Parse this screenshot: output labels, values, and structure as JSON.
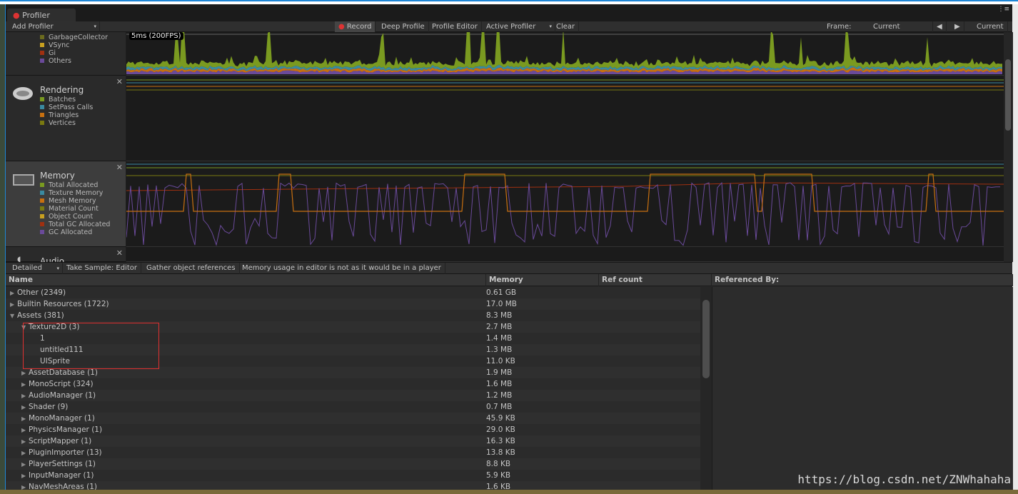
{
  "window": {
    "tab_title": "Profiler"
  },
  "toolbar": {
    "add_profiler": "Add Profiler",
    "record": "Record",
    "deep_profile": "Deep Profile",
    "profile_editor": "Profile Editor",
    "active_profiler": "Active Profiler",
    "clear": "Clear",
    "frame_label": "Frame:",
    "frame_value": "Current",
    "current": "Current"
  },
  "cpu": {
    "fps_label": "5ms (200FPS)",
    "legend": [
      {
        "label": "GarbageCollector",
        "color": "#6b6b1e"
      },
      {
        "label": "VSync",
        "color": "#c8a020"
      },
      {
        "label": "Gi",
        "color": "#a03010"
      },
      {
        "label": "Others",
        "color": "#6a4a9a"
      }
    ]
  },
  "rendering": {
    "title": "Rendering",
    "legend": [
      {
        "label": "Batches",
        "color": "#7a9a20"
      },
      {
        "label": "SetPass Calls",
        "color": "#3a8aa0"
      },
      {
        "label": "Triangles",
        "color": "#c87010"
      },
      {
        "label": "Vertices",
        "color": "#7a7a10"
      }
    ]
  },
  "memory": {
    "title": "Memory",
    "legend": [
      {
        "label": "Total Allocated",
        "color": "#7a9a20"
      },
      {
        "label": "Texture Memory",
        "color": "#3a8aa0"
      },
      {
        "label": "Mesh Memory",
        "color": "#c87010"
      },
      {
        "label": "Material Count",
        "color": "#7a7a10"
      },
      {
        "label": "Object Count",
        "color": "#c8a020"
      },
      {
        "label": "Total GC Allocated",
        "color": "#a03010"
      },
      {
        "label": "GC Allocated",
        "color": "#6a4a9a"
      }
    ]
  },
  "audio": {
    "title": "Audio"
  },
  "detail_toolbar": {
    "mode": "Detailed",
    "take_sample": "Take Sample: Editor",
    "gather": "Gather object references",
    "notice": "Memory usage in editor is not as it would be in a player"
  },
  "table": {
    "headers": {
      "name": "Name",
      "memory": "Memory",
      "ref_count": "Ref count",
      "referenced_by": "Referenced By:"
    },
    "rows": [
      {
        "name": "Other (2349)",
        "memory": "0.61 GB",
        "depth": 0,
        "state": "collapsed"
      },
      {
        "name": "Builtin Resources (1722)",
        "memory": "17.0 MB",
        "depth": 0,
        "state": "collapsed"
      },
      {
        "name": "Assets (381)",
        "memory": "8.3 MB",
        "depth": 0,
        "state": "expanded"
      },
      {
        "name": "Texture2D (3)",
        "memory": "2.7 MB",
        "depth": 1,
        "state": "expanded"
      },
      {
        "name": "1",
        "memory": "1.4 MB",
        "depth": 2,
        "state": "leaf"
      },
      {
        "name": "untitled111",
        "memory": "1.3 MB",
        "depth": 2,
        "state": "leaf"
      },
      {
        "name": "UISprite",
        "memory": "11.0 KB",
        "depth": 2,
        "state": "leaf"
      },
      {
        "name": "AssetDatabase (1)",
        "memory": "1.9 MB",
        "depth": 1,
        "state": "collapsed"
      },
      {
        "name": "MonoScript (324)",
        "memory": "1.6 MB",
        "depth": 1,
        "state": "collapsed"
      },
      {
        "name": "AudioManager (1)",
        "memory": "1.2 MB",
        "depth": 1,
        "state": "collapsed"
      },
      {
        "name": "Shader (9)",
        "memory": "0.7 MB",
        "depth": 1,
        "state": "collapsed"
      },
      {
        "name": "MonoManager (1)",
        "memory": "45.9 KB",
        "depth": 1,
        "state": "collapsed"
      },
      {
        "name": "PhysicsManager (1)",
        "memory": "29.0 KB",
        "depth": 1,
        "state": "collapsed"
      },
      {
        "name": "ScriptMapper (1)",
        "memory": "16.3 KB",
        "depth": 1,
        "state": "collapsed"
      },
      {
        "name": "PluginImporter (13)",
        "memory": "13.8 KB",
        "depth": 1,
        "state": "collapsed"
      },
      {
        "name": "PlayerSettings (1)",
        "memory": "8.8 KB",
        "depth": 1,
        "state": "collapsed"
      },
      {
        "name": "InputManager (1)",
        "memory": "5.9 KB",
        "depth": 1,
        "state": "collapsed"
      },
      {
        "name": "NavMeshAreas (1)",
        "memory": "1.6 KB",
        "depth": 1,
        "state": "collapsed"
      }
    ]
  },
  "watermark": "https://blog.csdn.net/ZNWhahaha"
}
